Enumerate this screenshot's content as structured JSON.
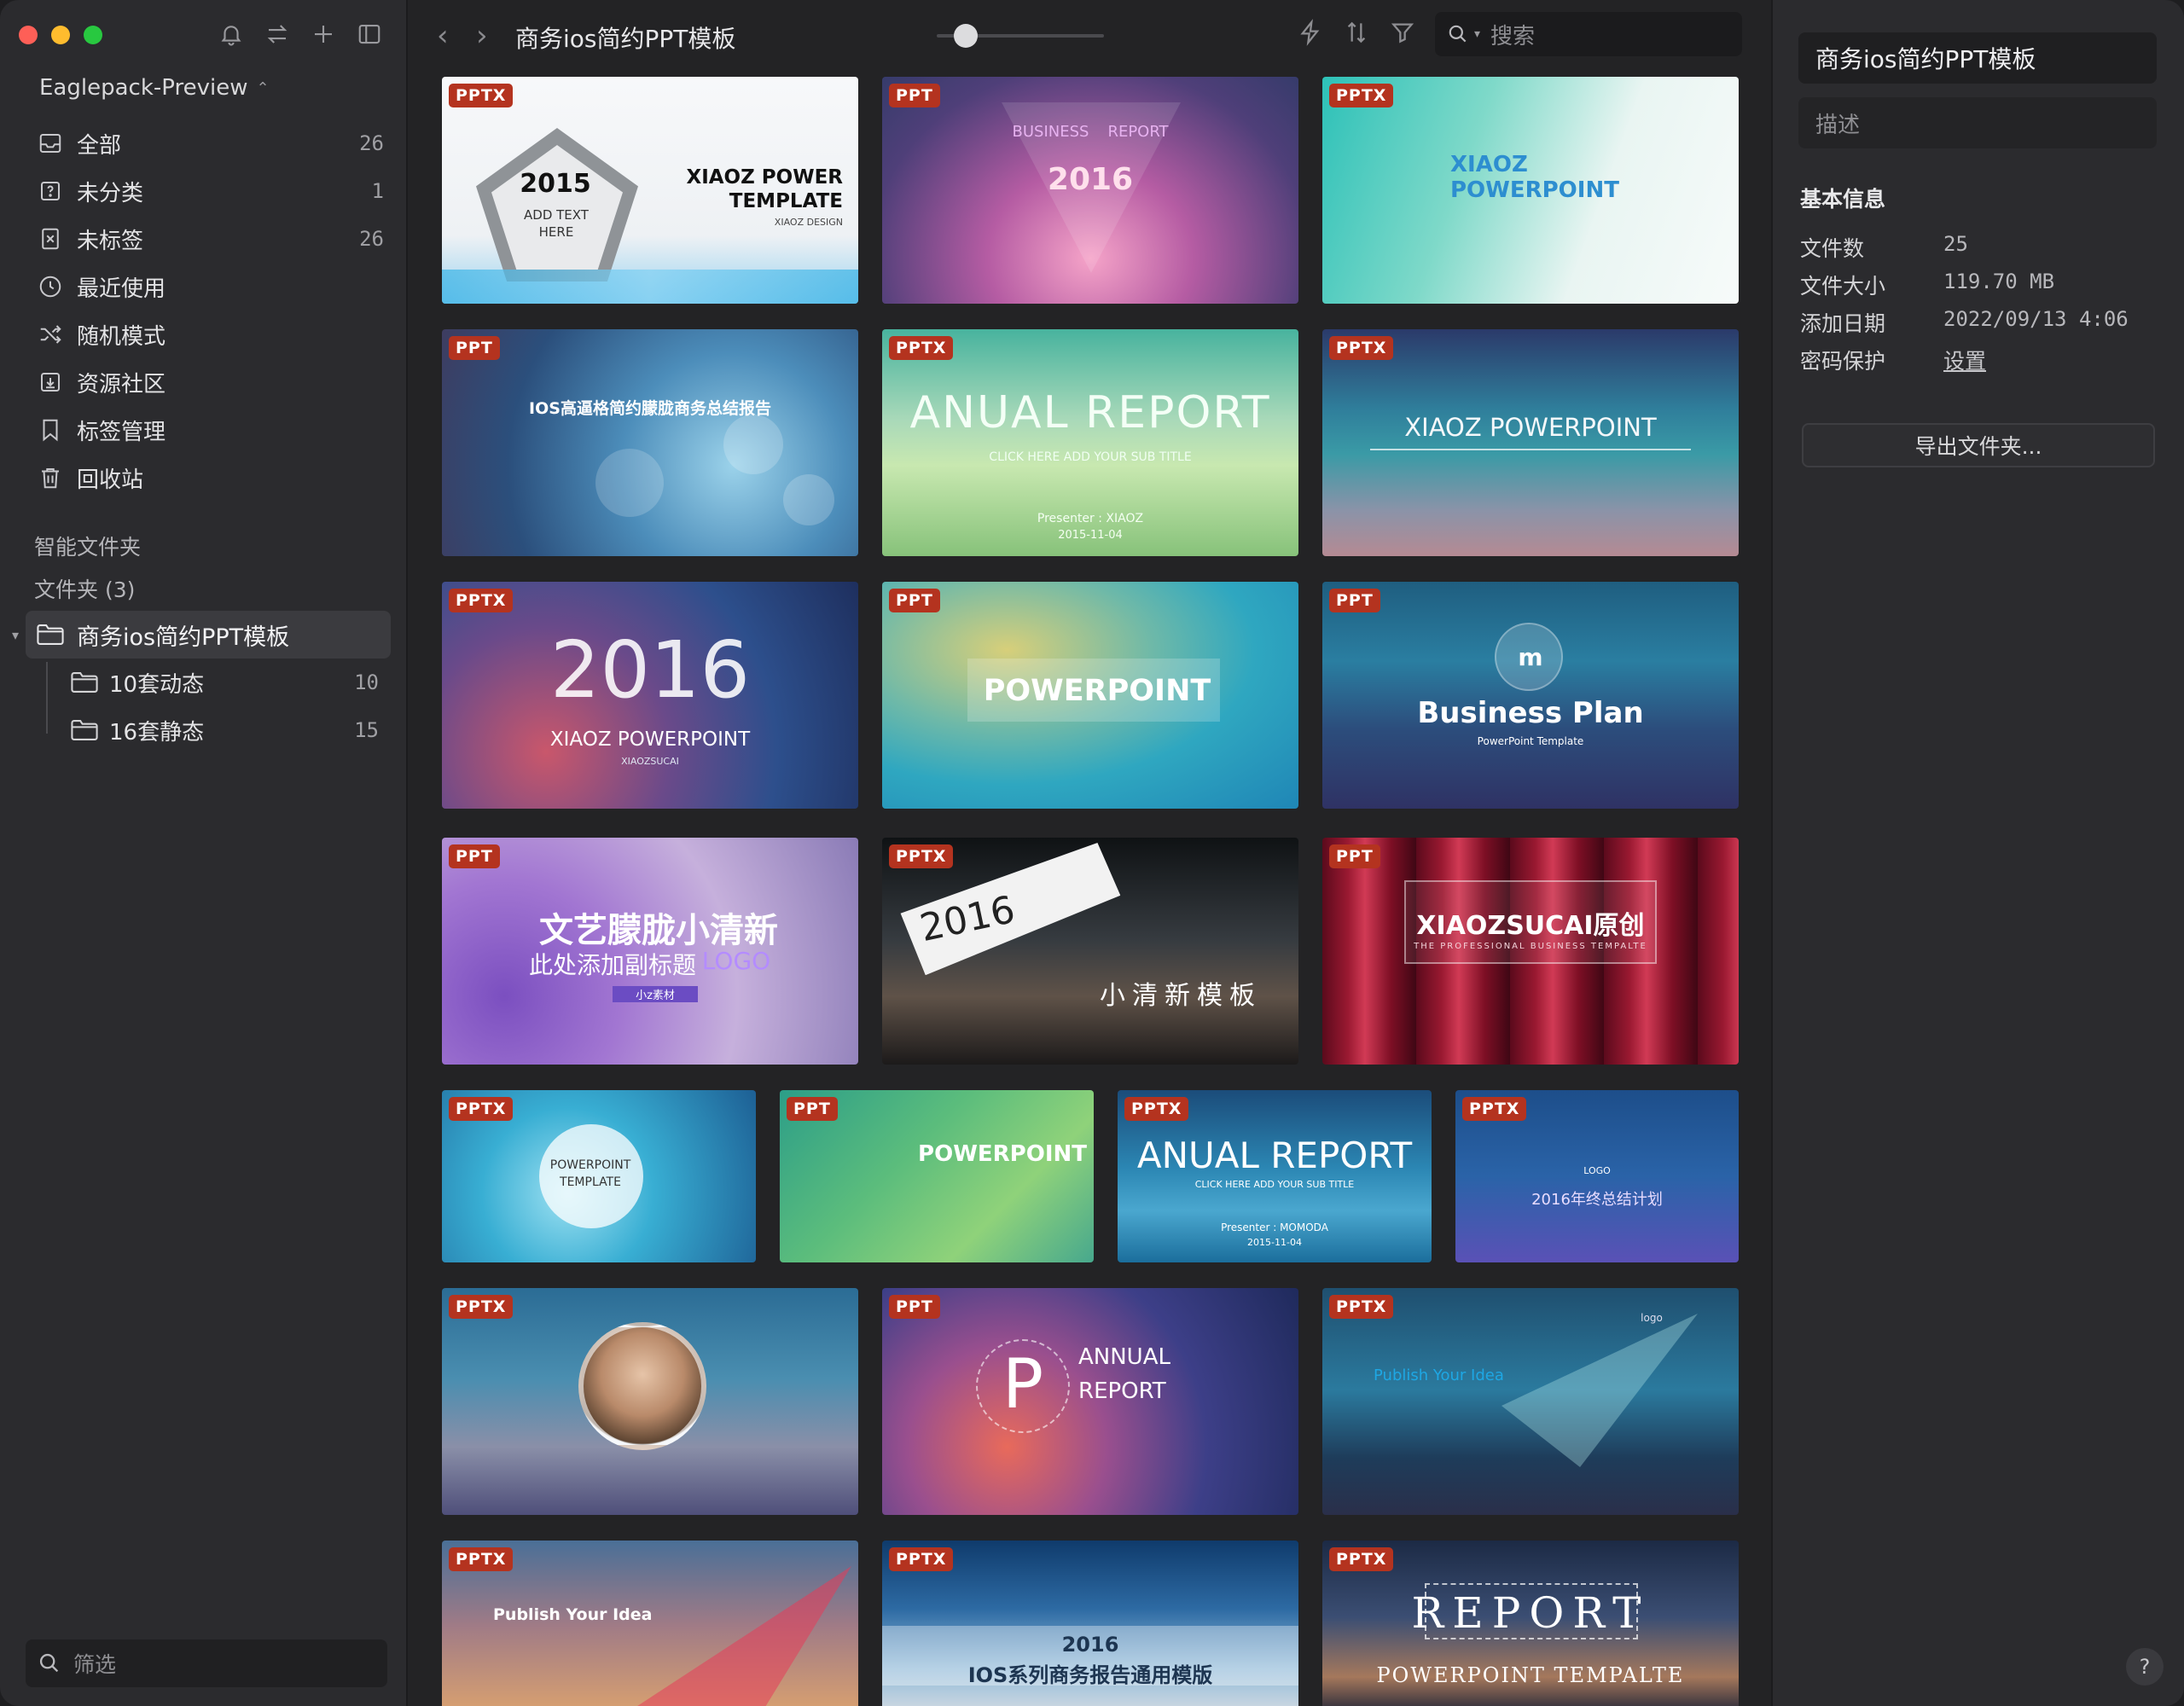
{
  "sidebar": {
    "library": "Eaglepack-Preview",
    "nav": [
      {
        "label": "全部",
        "count": "26",
        "icon": "inbox-icon"
      },
      {
        "label": "未分类",
        "count": "1",
        "icon": "question-box-icon"
      },
      {
        "label": "未标签",
        "count": "26",
        "icon": "untagged-icon"
      },
      {
        "label": "最近使用",
        "count": "",
        "icon": "clock-icon"
      },
      {
        "label": "随机模式",
        "count": "",
        "icon": "shuffle-icon"
      },
      {
        "label": "资源社区",
        "count": "",
        "icon": "download-box-icon"
      },
      {
        "label": "标签管理",
        "count": "",
        "icon": "bookmark-icon"
      },
      {
        "label": "回收站",
        "count": "",
        "icon": "trash-icon"
      }
    ],
    "smart_folders": "智能文件夹",
    "folders_header": "文件夹 (3)",
    "folder_root": "商务ios简约PPT模板",
    "subfolders": [
      {
        "label": "10套动态",
        "count": "10"
      },
      {
        "label": "16套静态",
        "count": "15"
      }
    ],
    "filter_placeholder": "筛选"
  },
  "toolbar": {
    "back": "‹",
    "forward": "›",
    "title": "商务ios简约PPT模板",
    "search_placeholder": "搜索"
  },
  "grid": {
    "cards": [
      {
        "badge": "PPTX",
        "l1": "2015",
        "l2": "ADD TEXT HERE",
        "l3": "XIAOZ POWER TEMPLATE",
        "l4": "XIAOZ DESIGN"
      },
      {
        "badge": "PPT",
        "l1": "BUSINESS",
        "l2": "REPORT",
        "l3": "2016"
      },
      {
        "badge": "PPTX",
        "l1": "XIAOZ",
        "l2": "POWERPOINT"
      },
      {
        "badge": "PPT",
        "l1": "IOS高逼格简约朦胧商务总结报告"
      },
      {
        "badge": "PPTX",
        "l1": "ANUAL REPORT",
        "l2": "CLICK HERE ADD YOUR SUB TITLE",
        "l3": "Presenter : XIAOZ",
        "l4": "2015-11-04"
      },
      {
        "badge": "PPTX",
        "l1": "XIAOZ POWERPOINT"
      },
      {
        "badge": "PPTX",
        "l1": "2016",
        "l2": "XIAOZ POWERPOINT",
        "l3": "XIAOZSUCAI"
      },
      {
        "badge": "PPT",
        "l1": "POWERPOINT"
      },
      {
        "badge": "PPT",
        "l1": "m",
        "l2": "Business Plan",
        "l3": "PowerPoint Template"
      },
      {
        "badge": "PPT",
        "l1": "文艺朦胧小清新",
        "l2": "此处添加副标题",
        "l3": "LOGO",
        "l4": "小z素材"
      },
      {
        "badge": "PPTX",
        "l1": "2016",
        "l2": "小清新模板"
      },
      {
        "badge": "PPT",
        "l1": "XIAOZSUCAI原创",
        "l2": "THE PROFESSIONAL BUSINESS TEMPALTE"
      },
      {
        "badge": "PPTX",
        "l1": "POWERPOINT",
        "l2": "TEMPLATE"
      },
      {
        "badge": "PPT",
        "l1": "POWERPOINT"
      },
      {
        "badge": "PPTX",
        "l1": "ANUAL REPORT",
        "l2": "CLICK HERE ADD YOUR SUB TITLE",
        "l3": "Presenter : MOMODA",
        "l4": "2015-11-04"
      },
      {
        "badge": "PPTX",
        "l1": "LOGO",
        "l2": "2016年终总结计划"
      },
      {
        "badge": "PPTX",
        "l1": ""
      },
      {
        "badge": "PPT",
        "l1": "P",
        "l2": "ANNUAL",
        "l3": "REPORT"
      },
      {
        "badge": "PPTX",
        "l1": "Publish Your Idea",
        "l2": "logo"
      },
      {
        "badge": "PPTX",
        "l1": "Publish Your Idea"
      },
      {
        "badge": "PPTX",
        "l1": "2016",
        "l2": "IOS系列商务报告通用模版"
      },
      {
        "badge": "PPTX",
        "l1": "REPORT",
        "l2": "POWERPOINT TEMPALTE"
      }
    ]
  },
  "inspector": {
    "title": "商务ios简约PPT模板",
    "description_placeholder": "描述",
    "section": "基本信息",
    "rows": [
      {
        "k": "文件数",
        "v": "25"
      },
      {
        "k": "文件大小",
        "v": "119.70 MB"
      },
      {
        "k": "添加日期",
        "v": "2022/09/13 4:06"
      },
      {
        "k": "密码保护",
        "v": "设置"
      }
    ],
    "export_label": "导出文件夹...",
    "help": "?"
  }
}
